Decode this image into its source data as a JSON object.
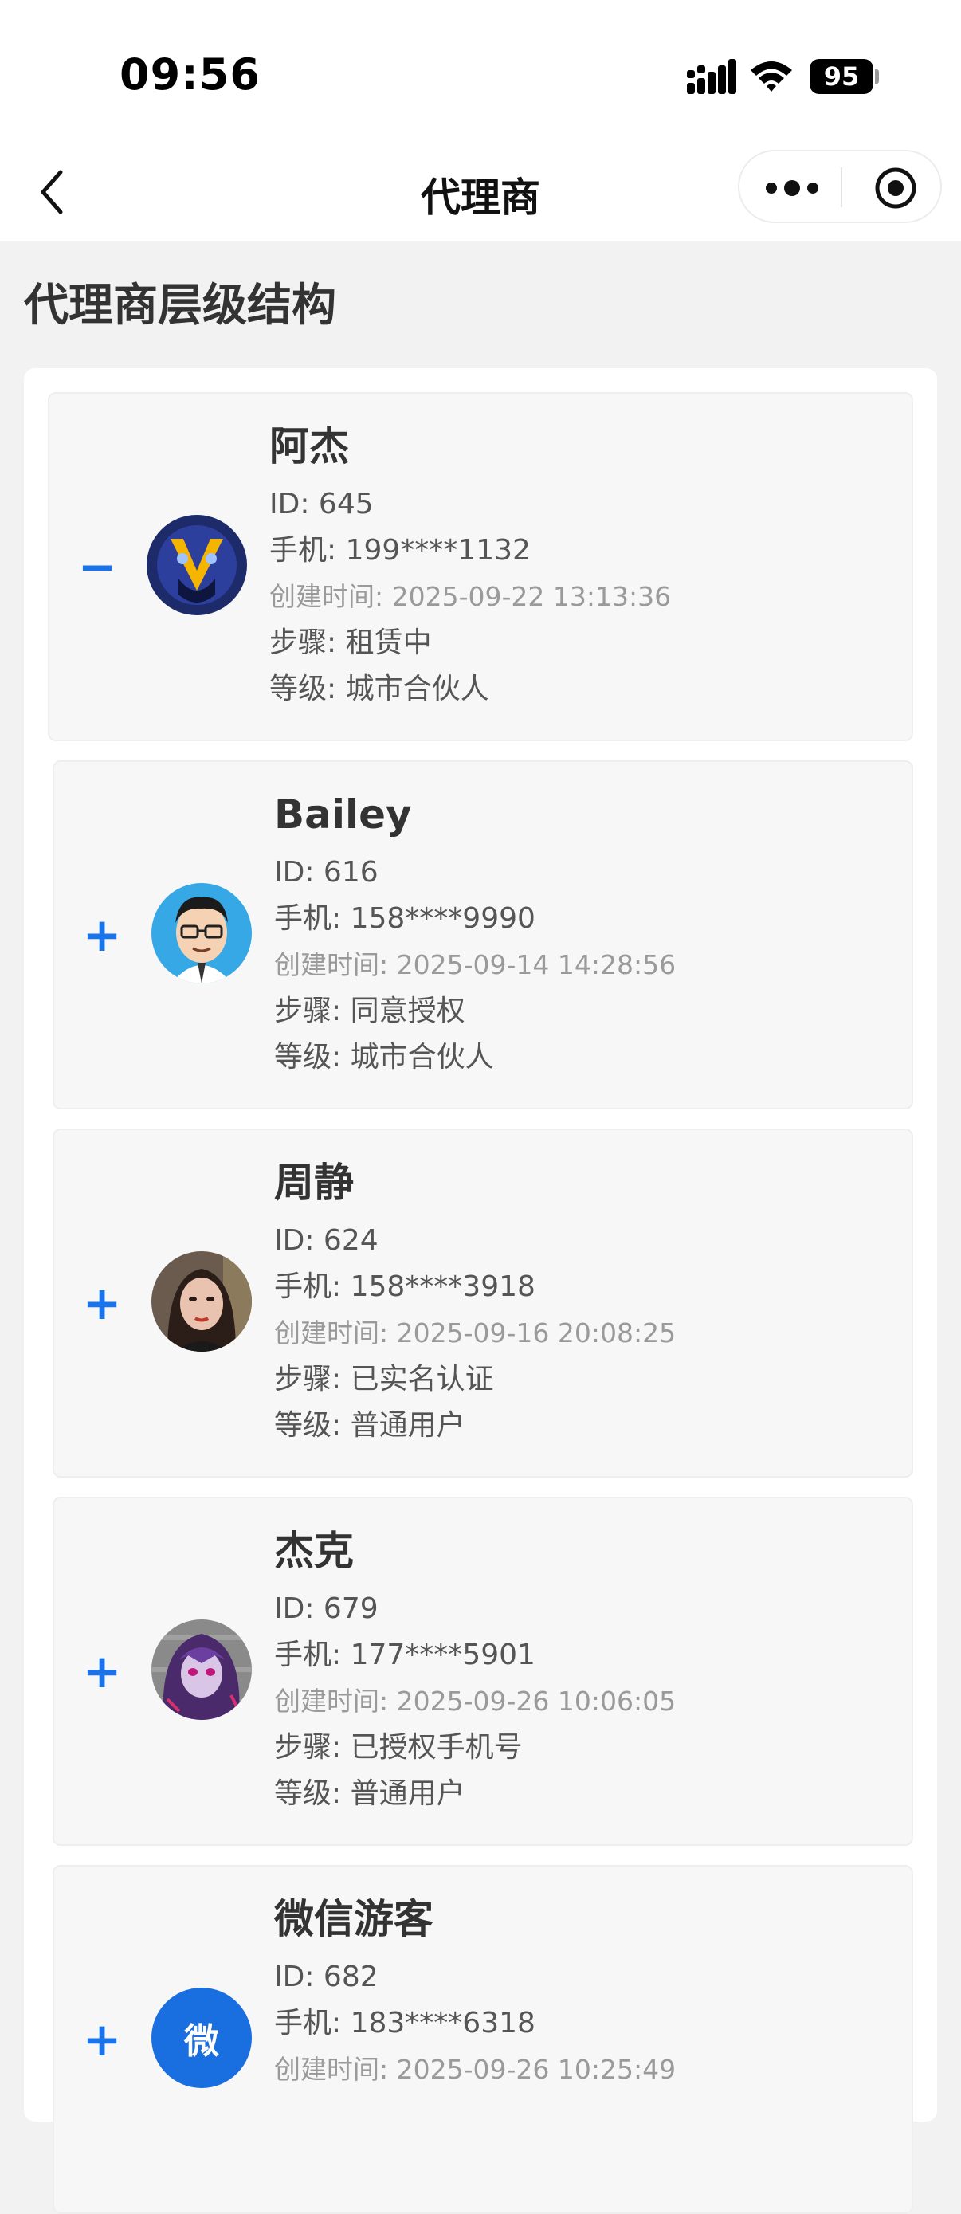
{
  "status_bar": {
    "time": "09:56",
    "battery": "95",
    "icons": [
      "signal-icon",
      "wifi-icon",
      "battery-icon"
    ]
  },
  "nav": {
    "title": "代理商",
    "icons": [
      "chevron-left-icon",
      "more-dots-icon",
      "target-circle-icon"
    ]
  },
  "page": {
    "title": "代理商层级结构"
  },
  "colors": {
    "accent": "#1a73e8",
    "card_bg": "#f7f7f7",
    "page_bg": "#f2f2f2"
  },
  "agents": [
    {
      "toggle": "−",
      "name": "阿杰",
      "id": "ID: 645",
      "phone": "手机: 199****1132",
      "created": "创建时间: 2025-09-22 13:13:36",
      "step": "步骤: 租赁中",
      "level": "等级: 城市合伙人",
      "avatar": "robot-avatar"
    },
    {
      "toggle": "+",
      "name": "Bailey",
      "id": "ID: 616",
      "phone": "手机: 158****9990",
      "created": "创建时间: 2025-09-14 14:28:56",
      "step": "步骤: 同意授权",
      "level": "等级: 城市合伙人",
      "avatar": "cartoon-man-avatar"
    },
    {
      "toggle": "+",
      "name": "周静",
      "id": "ID: 624",
      "phone": "手机: 158****3918",
      "created": "创建时间: 2025-09-16 20:08:25",
      "step": "步骤: 已实名认证",
      "level": "等级: 普通用户",
      "avatar": "woman-photo-avatar"
    },
    {
      "toggle": "+",
      "name": "杰克",
      "id": "ID: 679",
      "phone": "手机: 177****5901",
      "created": "创建时间: 2025-09-26 10:06:05",
      "step": "步骤: 已授权手机号",
      "level": "等级: 普通用户",
      "avatar": "anime-avatar"
    },
    {
      "toggle": "+",
      "name": "微信游客",
      "id": "ID: 682",
      "phone": "手机: 183****6318",
      "created": "创建时间: 2025-09-26 10:25:49",
      "step": "",
      "level": "",
      "avatar": "letter-avatar",
      "avatar_text": "微"
    }
  ]
}
